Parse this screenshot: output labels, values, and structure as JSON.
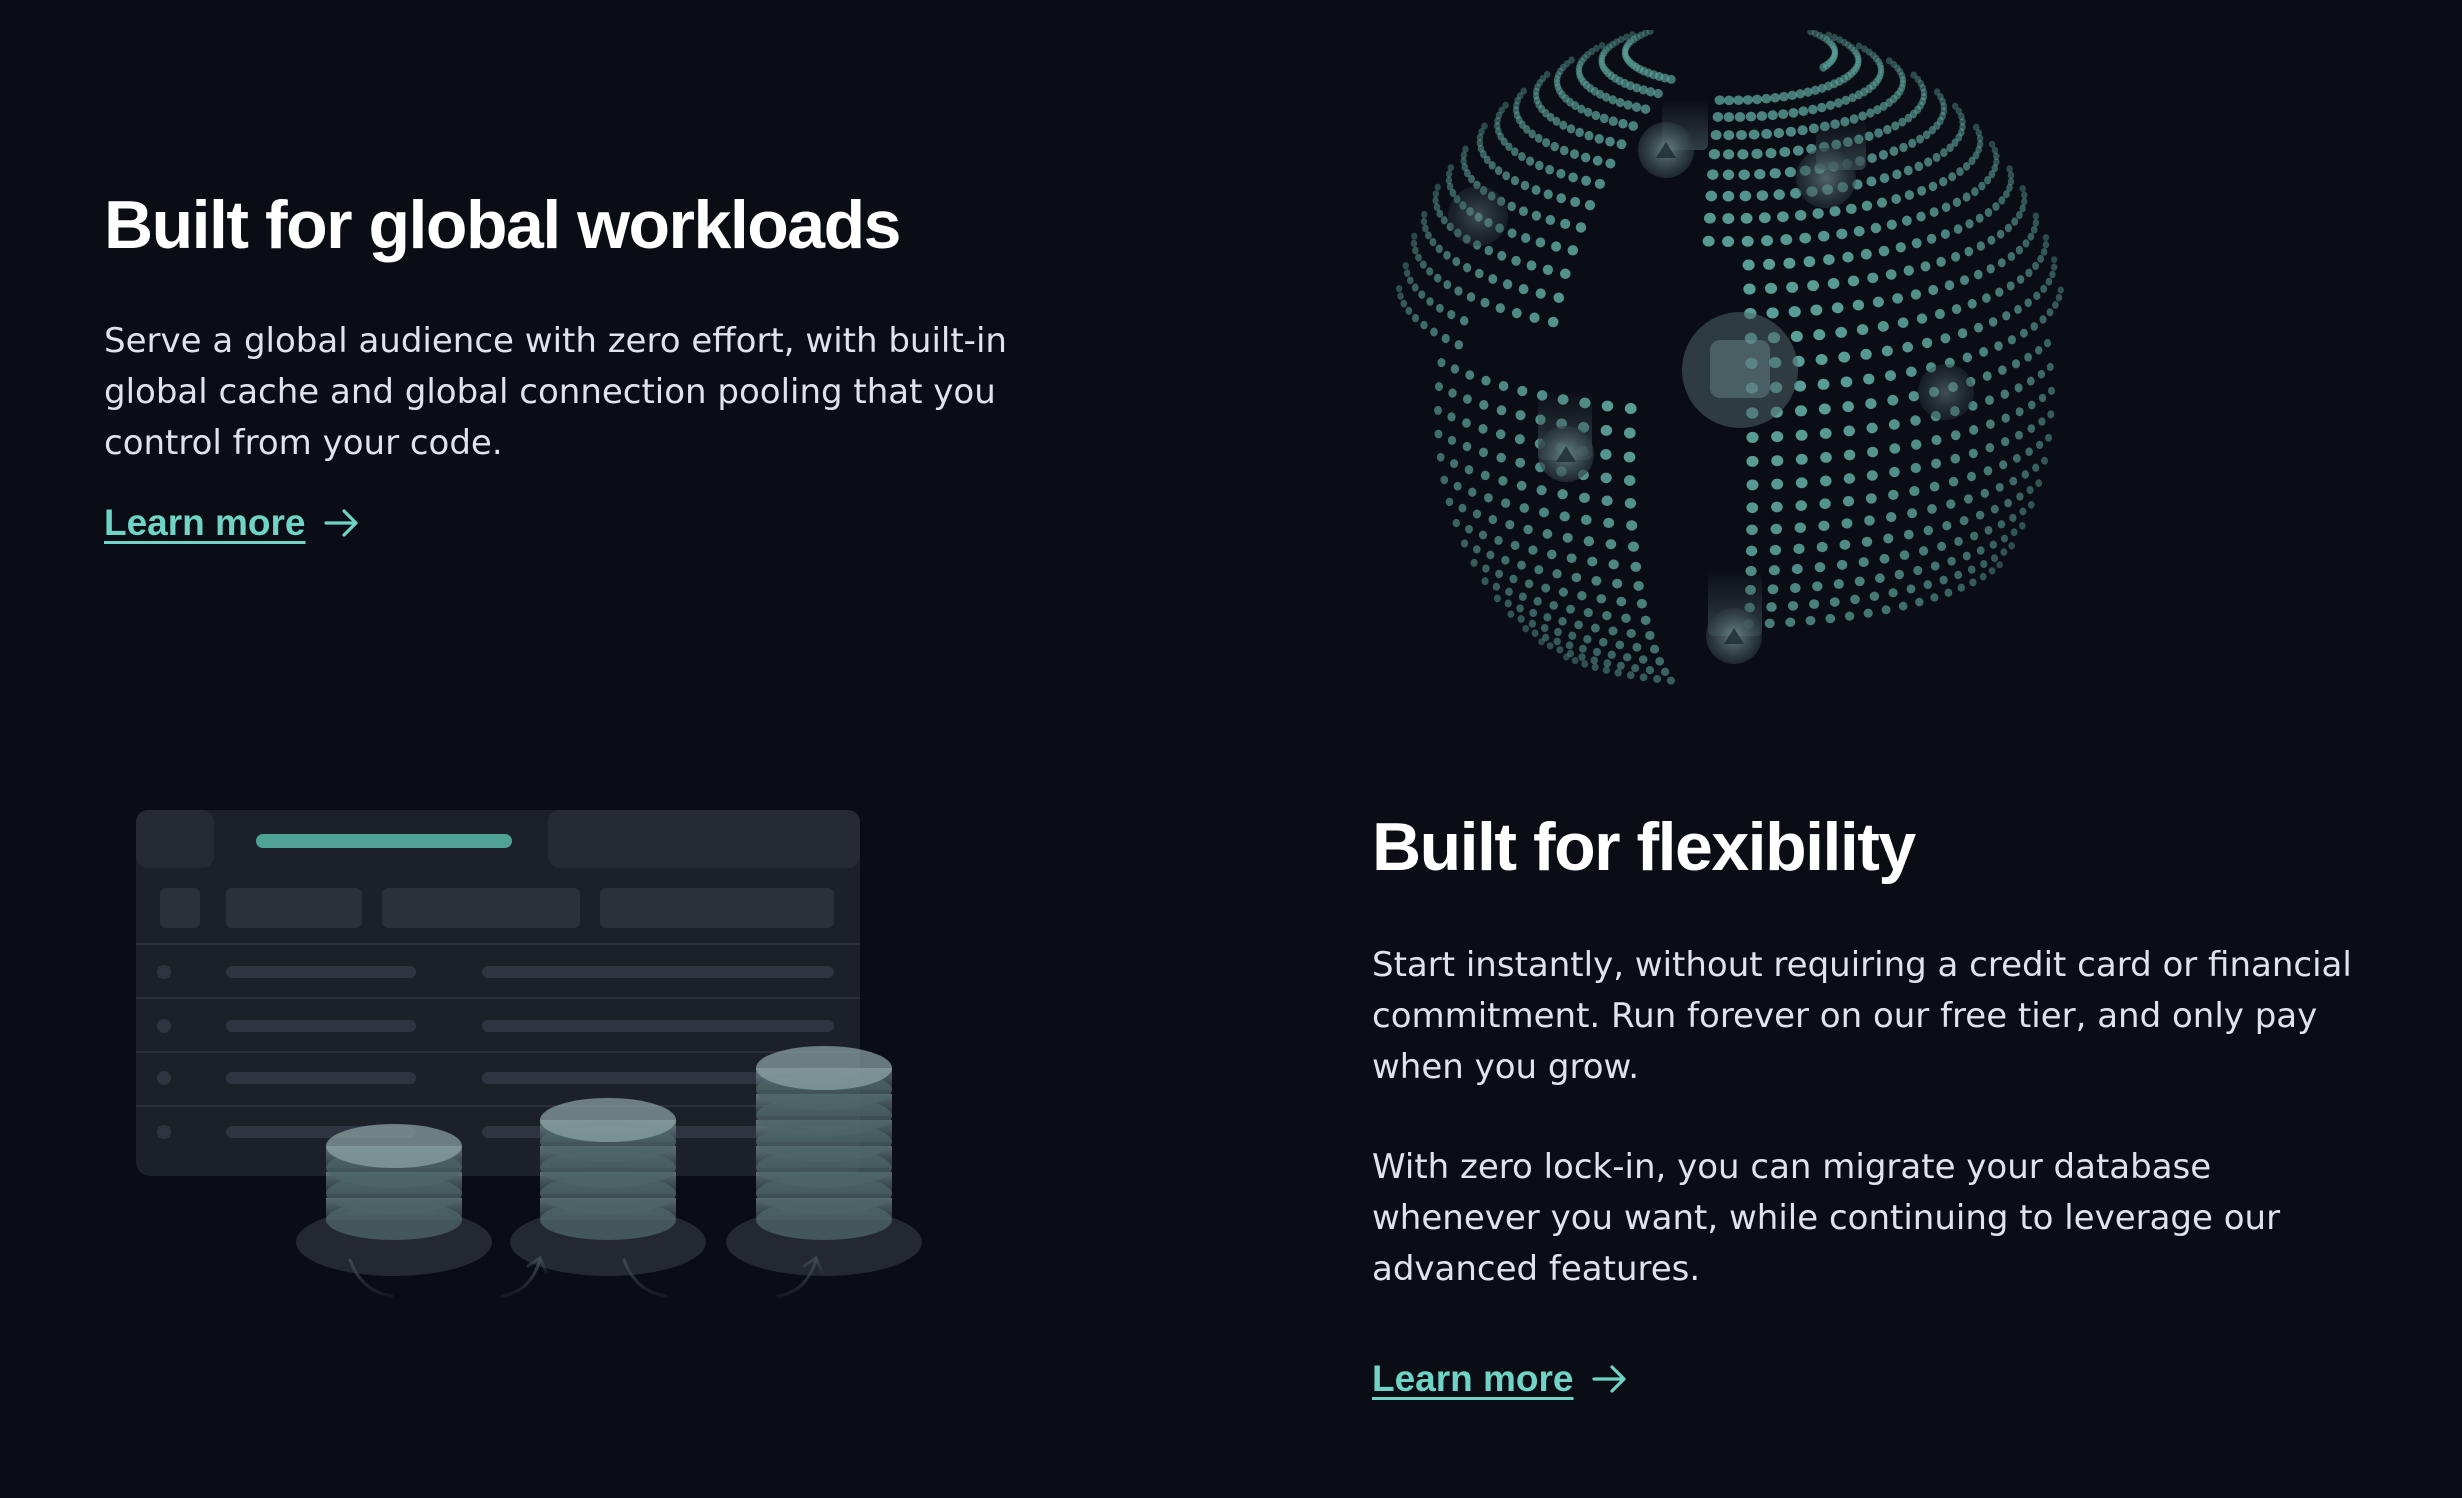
{
  "sections": [
    {
      "title": "Built for global workloads",
      "paragraphs": [
        "Serve a global audience with zero effort, with built-in global cache and global connection pooling that you control from your code."
      ],
      "link": {
        "label": "Learn more"
      }
    },
    {
      "title": "Built for flexibility",
      "paragraphs": [
        "Start instantly, without requiring a credit card or financial commitment. Run forever on our free tier, and only pay when you grow.",
        "With zero lock-in, you can migrate your database whenever you want, while continuing to leverage our advanced features."
      ],
      "link": {
        "label": "Learn more"
      }
    }
  ],
  "icons": {
    "link_arrow": "arrow-right-icon",
    "globe": "globe-illustration",
    "database": "database-stack-illustration"
  },
  "colors": {
    "background": "#0b0d15",
    "accent": "#6fd3c6",
    "heading": "#ffffff",
    "body": "#dfe3ea",
    "dot": "#5fa8a0"
  }
}
